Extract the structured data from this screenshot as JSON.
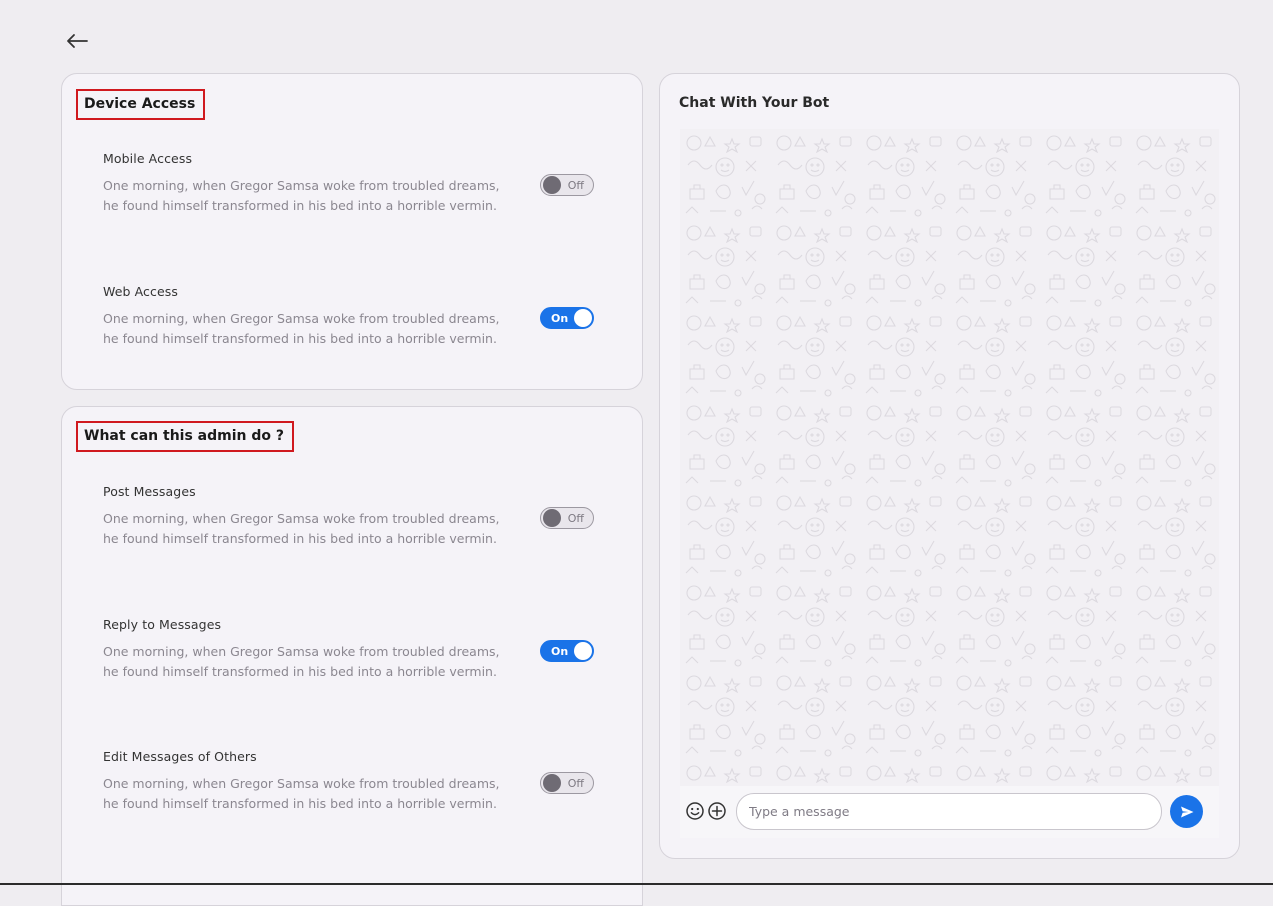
{
  "device_access": {
    "title": "Device Access",
    "settings": [
      {
        "label": "Mobile Access",
        "description_line1": "One morning, when Gregor Samsa woke from troubled dreams,",
        "description_line2": "he found himself transformed in his bed into a horrible vermin.",
        "toggle_state": "Off"
      },
      {
        "label": "Web Access",
        "description_line1": "One morning, when Gregor Samsa woke from troubled dreams,",
        "description_line2": "he found himself transformed in his bed into a horrible vermin.",
        "toggle_state": "On"
      }
    ]
  },
  "admin_permissions": {
    "title": "What can this admin do ?",
    "settings": [
      {
        "label": "Post Messages",
        "description_line1": "One morning, when Gregor Samsa woke from troubled dreams,",
        "description_line2": "he found himself transformed in his bed into a horrible vermin.",
        "toggle_state": "Off"
      },
      {
        "label": "Reply to Messages",
        "description_line1": "One morning, when Gregor Samsa woke from troubled dreams,",
        "description_line2": "he found himself transformed in his bed into a horrible vermin.",
        "toggle_state": "On"
      },
      {
        "label": "Edit Messages of Others",
        "description_line1": "One morning, when Gregor Samsa woke from troubled dreams,",
        "description_line2": "he found himself transformed in his bed into a horrible vermin.",
        "toggle_state": "Off"
      }
    ]
  },
  "chat": {
    "title": "Chat With Your Bot",
    "input_placeholder": "Type a message",
    "input_value": ""
  },
  "icons": {
    "back": "arrow-left-icon",
    "emoji": "smiley-icon",
    "attach": "plus-circle-icon",
    "send": "send-icon"
  },
  "colors": {
    "accent": "#1a73e8",
    "highlight_border": "#d0191f",
    "page_background": "#efedf1",
    "card_background": "#f5f3f8"
  }
}
